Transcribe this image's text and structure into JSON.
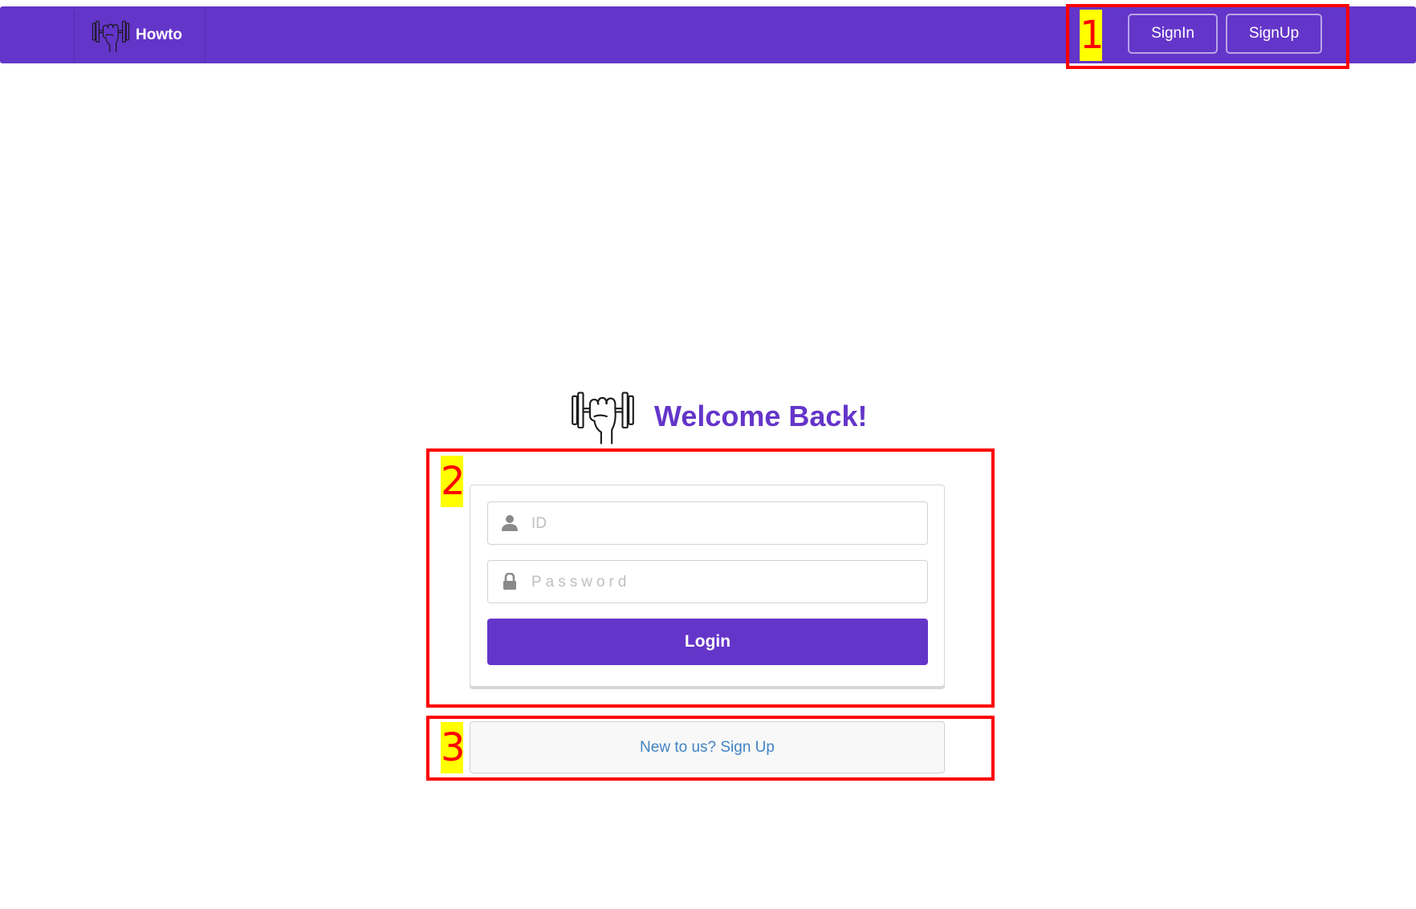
{
  "colors": {
    "primary": "#6435C9",
    "link": "#4183C4",
    "annotation": "#FF0000",
    "annotation_label_bg": "#FFFF00"
  },
  "navbar": {
    "brand_icon": "dumbbell-fist-icon",
    "brand_name": "Howto",
    "signin_label": "SignIn",
    "signup_label": "SignUp"
  },
  "login": {
    "logo_icon": "dumbbell-fist-icon",
    "title": "Welcome Back!",
    "id_icon": "user-icon",
    "id_placeholder": "ID",
    "id_value": "",
    "password_icon": "lock-icon",
    "password_placeholder": "Password",
    "password_value": "",
    "login_label": "Login"
  },
  "signup_message": {
    "text": "New to us? Sign Up"
  },
  "annotations": [
    {
      "label": "1"
    },
    {
      "label": "2"
    },
    {
      "label": "3"
    }
  ]
}
